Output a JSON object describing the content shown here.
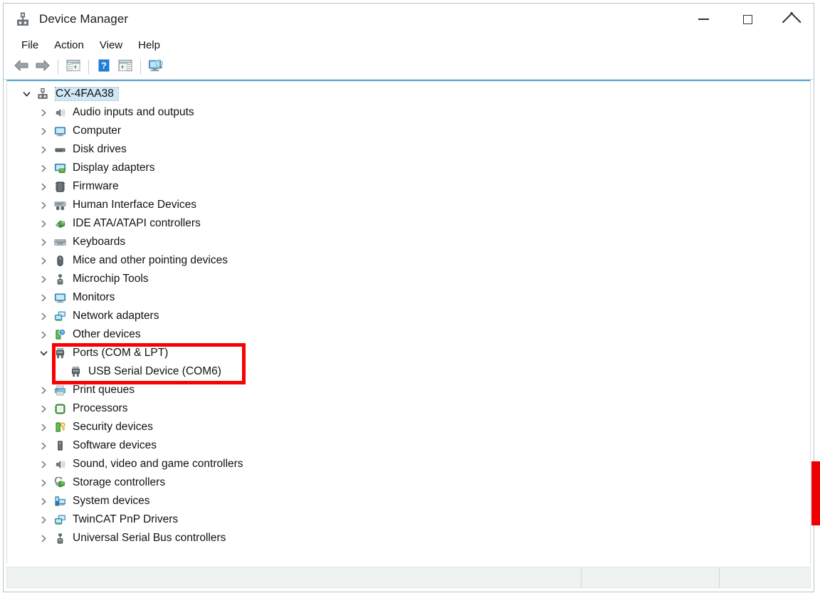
{
  "window": {
    "title": "Device Manager",
    "icon": "device-manager-icon",
    "controls": {
      "minimize": "minimize-button",
      "maximize": "maximize-button",
      "close": "close-button"
    }
  },
  "menubar": {
    "items": [
      {
        "label": "File"
      },
      {
        "label": "Action"
      },
      {
        "label": "View"
      },
      {
        "label": "Help"
      }
    ]
  },
  "toolbar": {
    "buttons": [
      {
        "name": "back-arrow-icon",
        "title": "Back"
      },
      {
        "name": "forward-arrow-icon",
        "title": "Forward"
      },
      {
        "name": "show-hide-console-tree-icon",
        "title": "Show/Hide Console Tree"
      },
      {
        "name": "help-question-icon",
        "title": "Help"
      },
      {
        "name": "properties-icon",
        "title": "Properties"
      },
      {
        "name": "scan-for-hardware-changes-icon",
        "title": "Scan for hardware changes"
      }
    ]
  },
  "tree": {
    "root": {
      "label": "CX-4FAA38",
      "icon": "computer-node-icon",
      "expanded": true,
      "selected": true
    },
    "items": [
      {
        "label": "Audio inputs and outputs",
        "icon": "speaker-icon",
        "expanded": false,
        "depth": 1
      },
      {
        "label": "Computer",
        "icon": "monitor-icon",
        "expanded": false,
        "depth": 1
      },
      {
        "label": "Disk drives",
        "icon": "disk-drive-icon",
        "expanded": false,
        "depth": 1
      },
      {
        "label": "Display adapters",
        "icon": "display-adapter-icon",
        "expanded": false,
        "depth": 1
      },
      {
        "label": "Firmware",
        "icon": "firmware-chip-icon",
        "expanded": false,
        "depth": 1
      },
      {
        "label": "Human Interface Devices",
        "icon": "hid-icon",
        "expanded": false,
        "depth": 1
      },
      {
        "label": "IDE ATA/ATAPI controllers",
        "icon": "ide-controller-icon",
        "expanded": false,
        "depth": 1
      },
      {
        "label": "Keyboards",
        "icon": "keyboard-icon",
        "expanded": false,
        "depth": 1
      },
      {
        "label": "Mice and other pointing devices",
        "icon": "mouse-icon",
        "expanded": false,
        "depth": 1
      },
      {
        "label": "Microchip Tools",
        "icon": "usb-device-icon",
        "expanded": false,
        "depth": 1
      },
      {
        "label": "Monitors",
        "icon": "monitor-icon",
        "expanded": false,
        "depth": 1
      },
      {
        "label": "Network adapters",
        "icon": "network-adapter-icon",
        "expanded": false,
        "depth": 1
      },
      {
        "label": "Other devices",
        "icon": "other-devices-question-icon",
        "expanded": false,
        "depth": 1
      },
      {
        "label": "Ports (COM & LPT)",
        "icon": "port-icon",
        "expanded": true,
        "depth": 1
      },
      {
        "label": "USB Serial Device (COM6)",
        "icon": "port-icon",
        "expanded": null,
        "depth": 2
      },
      {
        "label": "Print queues",
        "icon": "printer-icon",
        "expanded": false,
        "depth": 1
      },
      {
        "label": "Processors",
        "icon": "processor-icon",
        "expanded": false,
        "depth": 1
      },
      {
        "label": "Security devices",
        "icon": "security-device-icon",
        "expanded": false,
        "depth": 1
      },
      {
        "label": "Software devices",
        "icon": "software-device-icon",
        "expanded": false,
        "depth": 1
      },
      {
        "label": "Sound, video and game controllers",
        "icon": "speaker-icon",
        "expanded": false,
        "depth": 1
      },
      {
        "label": "Storage controllers",
        "icon": "storage-controller-icon",
        "expanded": false,
        "depth": 1
      },
      {
        "label": "System devices",
        "icon": "system-device-icon",
        "expanded": false,
        "depth": 1
      },
      {
        "label": "TwinCAT PnP Drivers",
        "icon": "network-adapter-icon",
        "expanded": false,
        "depth": 1
      },
      {
        "label": "Universal Serial Bus controllers",
        "icon": "usb-device-icon",
        "expanded": false,
        "depth": 1
      }
    ]
  },
  "annotations": {
    "highlight_box": {
      "name": "ports-highlight-box",
      "color": "#fb0000",
      "covers": [
        "Ports (COM & LPT)",
        "USB Serial Device (COM6)"
      ]
    },
    "right_edge_mark": {
      "name": "right-edge-red-mark",
      "color": "#ee0000"
    }
  },
  "statusbar": {
    "panes": [
      "",
      "",
      ""
    ]
  },
  "colors": {
    "accent": "#5ba7d4",
    "selection": "#cde8f6",
    "annotation": "#fb0000",
    "window_border": "#b9c4c9"
  }
}
